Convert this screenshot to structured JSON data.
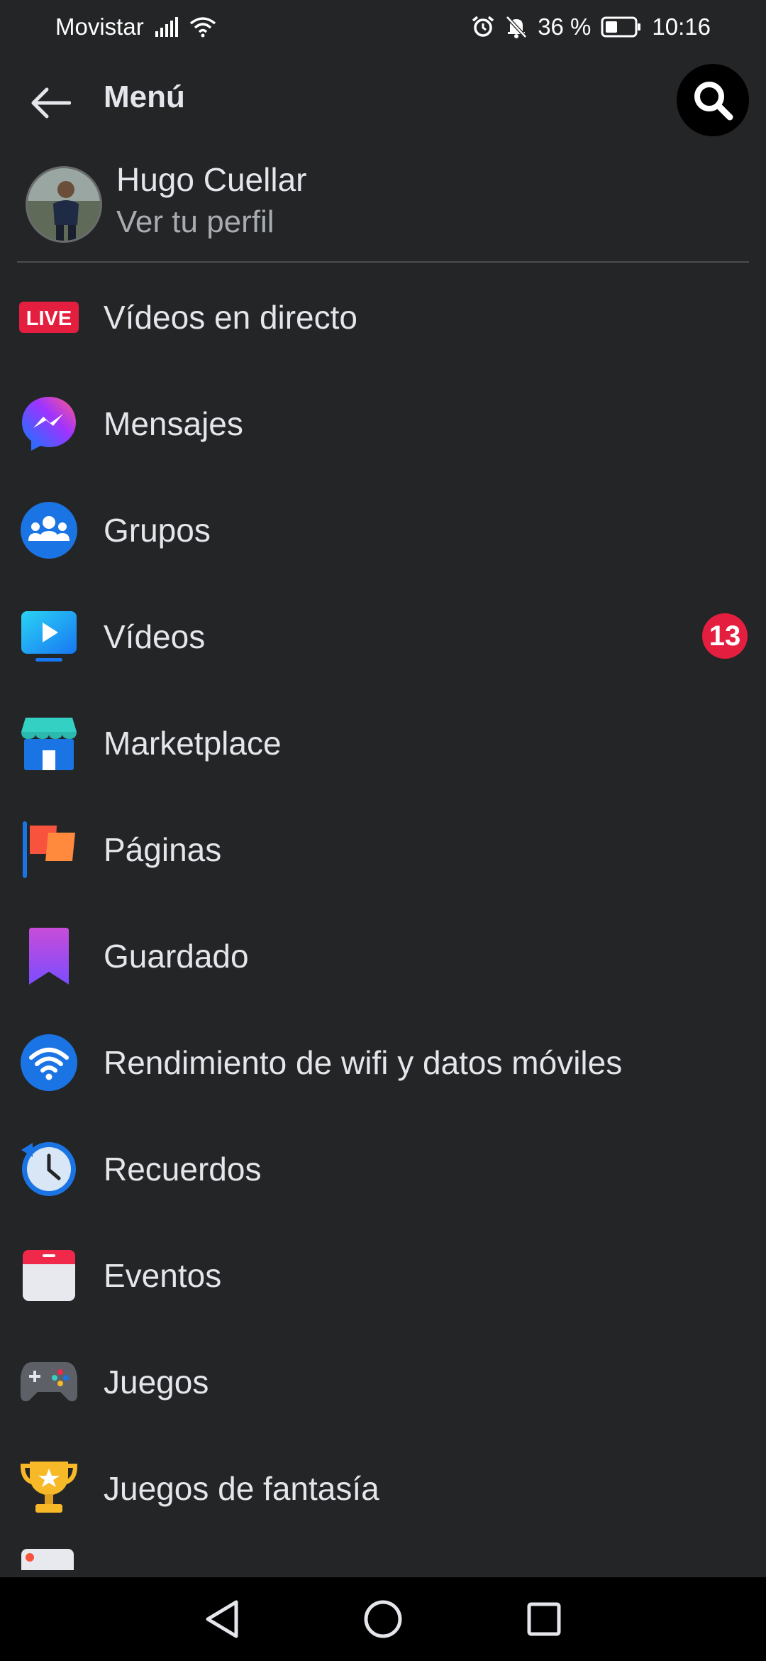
{
  "status": {
    "carrier": "Movistar",
    "battery": "36 %",
    "time": "10:16"
  },
  "header": {
    "title": "Menú"
  },
  "profile": {
    "name": "Hugo Cuellar",
    "subtitle": "Ver tu perfil"
  },
  "menu": [
    {
      "label": "Vídeos en directo",
      "icon": "live-icon"
    },
    {
      "label": "Mensajes",
      "icon": "messenger-icon"
    },
    {
      "label": "Grupos",
      "icon": "groups-icon"
    },
    {
      "label": "Vídeos",
      "icon": "video-icon",
      "badge": "13"
    },
    {
      "label": "Marketplace",
      "icon": "marketplace-icon"
    },
    {
      "label": "Páginas",
      "icon": "flag-icon"
    },
    {
      "label": "Guardado",
      "icon": "bookmark-icon"
    },
    {
      "label": "Rendimiento de wifi y datos móviles",
      "icon": "wifi-icon"
    },
    {
      "label": "Recuerdos",
      "icon": "memories-clock-icon"
    },
    {
      "label": "Eventos",
      "icon": "calendar-icon"
    },
    {
      "label": "Juegos",
      "icon": "gamepad-icon"
    },
    {
      "label": "Juegos de fantasía",
      "icon": "trophy-icon"
    }
  ],
  "live_badge_text": "LIVE",
  "colors": {
    "background": "#242526",
    "text": "#e4e6eb",
    "secondary_text": "#a8abaf",
    "badge": "#e41e3f",
    "accent_blue": "#1877f2"
  }
}
